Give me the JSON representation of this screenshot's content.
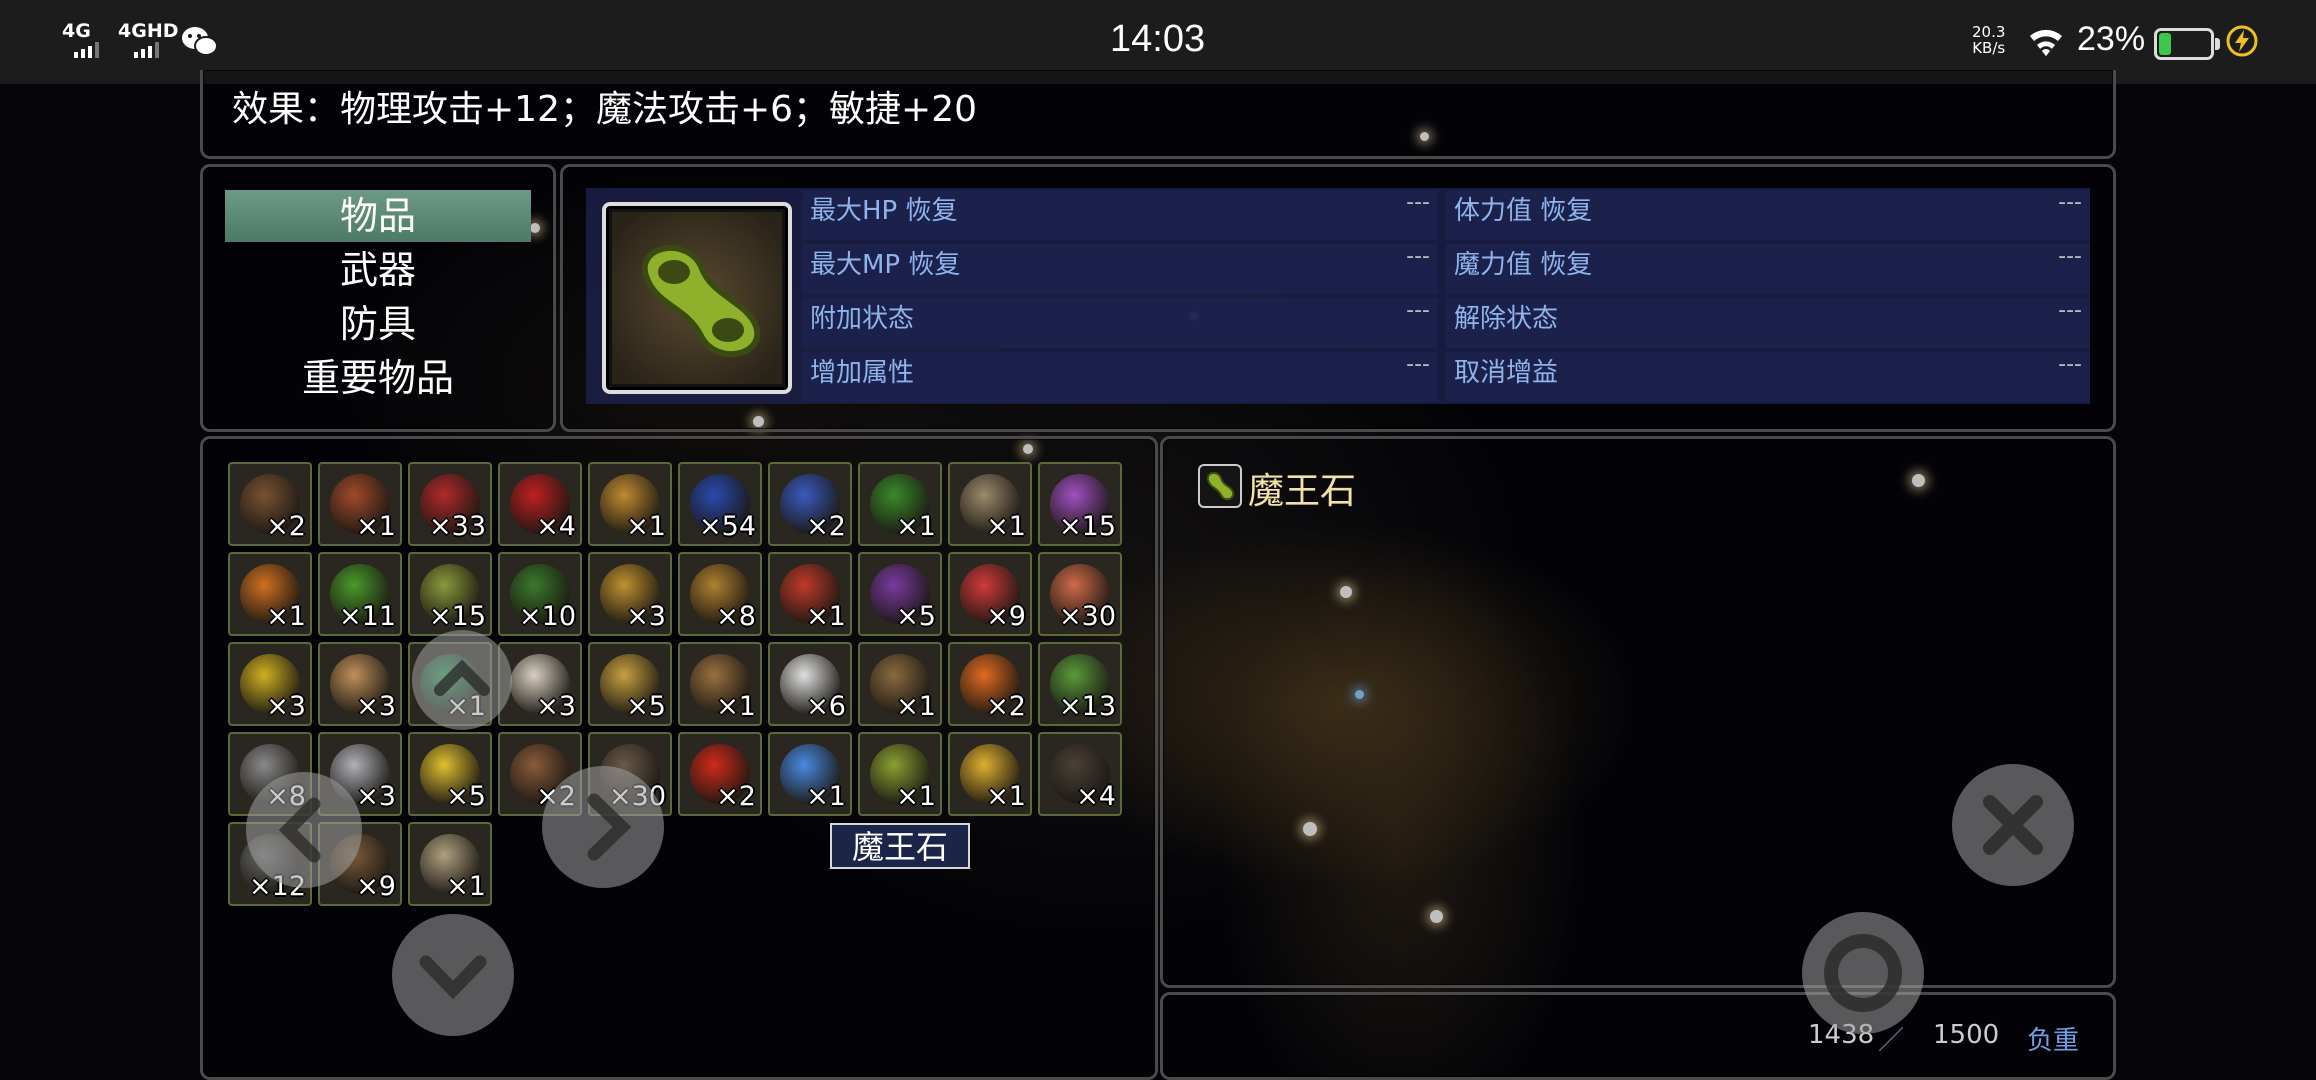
{
  "statusbar": {
    "net1": "4G",
    "net2": "4GHD",
    "time": "14:03",
    "speed_value": "20.3",
    "speed_unit": "KB/s",
    "battery_pct": "23%",
    "battery_level": 0.23,
    "icons": [
      "signal-icon",
      "signal-icon",
      "wechat-icon",
      "wifi-icon",
      "battery-icon",
      "charging-icon"
    ]
  },
  "effect": {
    "text": "效果：物理攻击+12；魔法攻击+6；敏捷+20"
  },
  "categories": [
    {
      "label": "物品",
      "selected": true
    },
    {
      "label": "武器",
      "selected": false
    },
    {
      "label": "防具",
      "selected": false
    },
    {
      "label": "重要物品",
      "selected": false
    }
  ],
  "stats": {
    "left": [
      {
        "label": "最大HP 恢复",
        "value": "---"
      },
      {
        "label": "最大MP 恢复",
        "value": "---"
      },
      {
        "label": "附加状态",
        "value": "---"
      },
      {
        "label": "增加属性",
        "value": "---"
      }
    ],
    "right": [
      {
        "label": "体力值 恢复",
        "value": "---"
      },
      {
        "label": "魔力值 恢复",
        "value": "---"
      },
      {
        "label": "解除状态",
        "value": "---"
      },
      {
        "label": "取消增益",
        "value": "---"
      }
    ]
  },
  "items": [
    {
      "qty": "×2",
      "color": "#7a5232"
    },
    {
      "qty": "×1",
      "color": "#a04a2a"
    },
    {
      "qty": "×33",
      "color": "#b02a2a"
    },
    {
      "qty": "×4",
      "color": "#c02020"
    },
    {
      "qty": "×1",
      "color": "#c08a30"
    },
    {
      "qty": "×54",
      "color": "#2a4ab0"
    },
    {
      "qty": "×2",
      "color": "#3a5ac0"
    },
    {
      "qty": "×1",
      "color": "#3a8a2a"
    },
    {
      "qty": "×1",
      "color": "#9a8a6a"
    },
    {
      "qty": "×15",
      "color": "#a050c0"
    },
    {
      "qty": "×1",
      "color": "#d07020"
    },
    {
      "qty": "×11",
      "color": "#4a9a2a"
    },
    {
      "qty": "×15",
      "color": "#8a9a3a"
    },
    {
      "qty": "×10",
      "color": "#3a7a2a"
    },
    {
      "qty": "×3",
      "color": "#c09030"
    },
    {
      "qty": "×8",
      "color": "#b08030"
    },
    {
      "qty": "×1",
      "color": "#c03a2a"
    },
    {
      "qty": "×5",
      "color": "#7a3aa0"
    },
    {
      "qty": "×9",
      "color": "#d03a3a"
    },
    {
      "qty": "×30",
      "color": "#d06a4a"
    },
    {
      "qty": "×3",
      "color": "#d0b020"
    },
    {
      "qty": "×3",
      "color": "#c0905a"
    },
    {
      "qty": "×1",
      "color": "#2a9a5a"
    },
    {
      "qty": "×3",
      "color": "#d8d0c0"
    },
    {
      "qty": "×5",
      "color": "#c8a040"
    },
    {
      "qty": "×1",
      "color": "#9a7040"
    },
    {
      "qty": "×6",
      "color": "#e0e0e0"
    },
    {
      "qty": "×1",
      "color": "#8a6a40"
    },
    {
      "qty": "×2",
      "color": "#e06a20"
    },
    {
      "qty": "×13",
      "color": "#5a9a3a"
    },
    {
      "qty": "×8",
      "color": "#8a8a8a"
    },
    {
      "qty": "×3",
      "color": "#b0b0b8"
    },
    {
      "qty": "×5",
      "color": "#e0c030"
    },
    {
      "qty": "×2",
      "color": "#8a5a3a"
    },
    {
      "qty": "×30",
      "color": "#6a5a4a"
    },
    {
      "qty": "×2",
      "color": "#d02a1a"
    },
    {
      "qty": "×1",
      "color": "#4a8ae0"
    },
    {
      "qty": "×1",
      "color": "#8aa030"
    },
    {
      "qty": "×1",
      "color": "#e0b030"
    },
    {
      "qty": "×4",
      "color": "#4a4038"
    },
    {
      "qty": "×12",
      "color": "#6a6a6a"
    },
    {
      "qty": "×9",
      "color": "#7a5a3a"
    },
    {
      "qty": "×1",
      "color": "#b0a080"
    }
  ],
  "tooltip": {
    "text": "魔王石"
  },
  "detail": {
    "name": "魔王石"
  },
  "weight": {
    "current": "1438",
    "separator": "／",
    "max": "1500",
    "label": "负重"
  },
  "controls": [
    "up-arrow-button",
    "left-arrow-button",
    "right-arrow-button",
    "down-arrow-button",
    "close-button",
    "confirm-button"
  ]
}
